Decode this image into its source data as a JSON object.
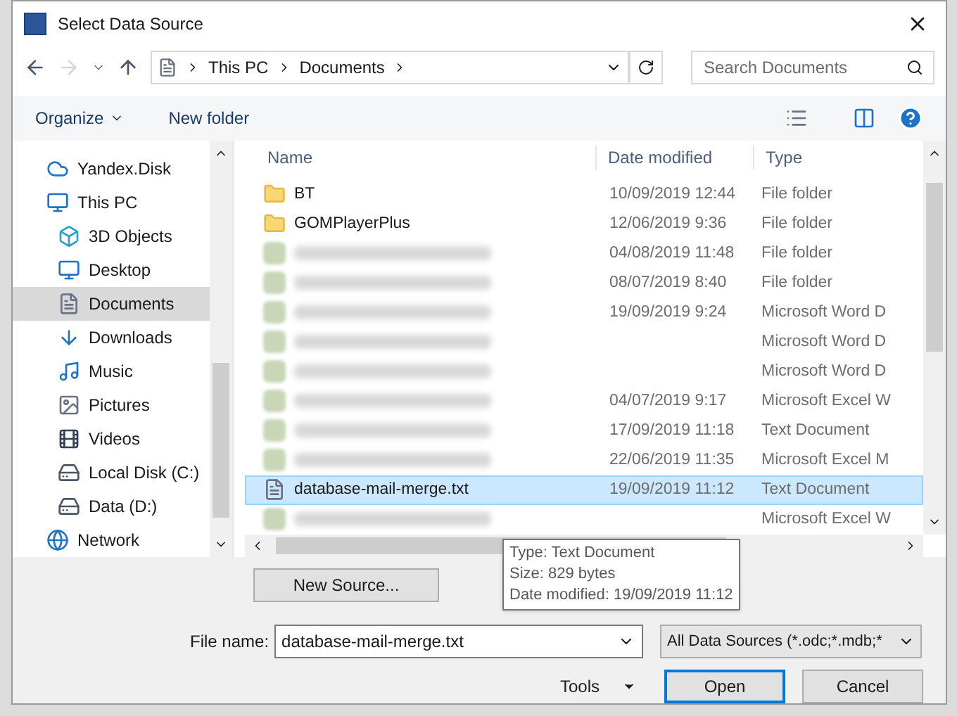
{
  "window": {
    "title": "Select Data Source"
  },
  "address": {
    "path": [
      "This PC",
      "Documents"
    ]
  },
  "search": {
    "placeholder": "Search Documents"
  },
  "toolbar": {
    "organize": "Organize",
    "new_folder": "New folder"
  },
  "sidebar": {
    "items": [
      {
        "label": "Yandex.Disk",
        "kind": "cloud",
        "selected": false
      },
      {
        "label": "This PC",
        "kind": "pc",
        "selected": false,
        "children": [
          {
            "label": "3D Objects",
            "kind": "cube",
            "selected": false
          },
          {
            "label": "Desktop",
            "kind": "desktop",
            "selected": false
          },
          {
            "label": "Documents",
            "kind": "document",
            "selected": true
          },
          {
            "label": "Downloads",
            "kind": "download",
            "selected": false
          },
          {
            "label": "Music",
            "kind": "music",
            "selected": false
          },
          {
            "label": "Pictures",
            "kind": "picture",
            "selected": false
          },
          {
            "label": "Videos",
            "kind": "video",
            "selected": false
          },
          {
            "label": "Local Disk (C:)",
            "kind": "drive",
            "selected": false
          },
          {
            "label": "Data (D:)",
            "kind": "drive",
            "selected": false
          }
        ]
      },
      {
        "label": "Network",
        "kind": "network",
        "selected": false
      }
    ]
  },
  "table": {
    "columns": [
      "Name",
      "Date modified",
      "Type"
    ],
    "rows": [
      {
        "kind": "folder",
        "name": "BT",
        "date": "10/09/2019 12:44",
        "type": "File folder",
        "selected": false
      },
      {
        "kind": "folder",
        "name": "GOMPlayerPlus",
        "date": "12/06/2019 9:36",
        "type": "File folder",
        "selected": false
      },
      {
        "kind": "obscured",
        "date": "04/08/2019 11:48",
        "type": "File folder",
        "selected": false
      },
      {
        "kind": "obscured",
        "date": "08/07/2019 8:40",
        "type": "File folder",
        "selected": false
      },
      {
        "kind": "obscured",
        "date": "19/09/2019 9:24",
        "type": "Microsoft Word D",
        "selected": false
      },
      {
        "kind": "obscured",
        "type": "Microsoft Word D",
        "selected": false
      },
      {
        "kind": "obscured",
        "type": "Microsoft Word D",
        "selected": false
      },
      {
        "kind": "obscured",
        "date": "04/07/2019 9:17",
        "type": "Microsoft Excel W",
        "selected": false
      },
      {
        "kind": "obscured",
        "date": "17/09/2019 11:18",
        "type": "Text Document",
        "selected": false
      },
      {
        "kind": "obscured",
        "date": "22/06/2019 11:35",
        "type": "Microsoft Excel M",
        "selected": false
      },
      {
        "kind": "text",
        "name": "database-mail-merge.txt",
        "date": "19/09/2019 11:12",
        "type": "Text Document",
        "selected": true
      },
      {
        "kind": "obscured",
        "type": "Microsoft Excel W",
        "selected": false
      }
    ]
  },
  "tooltip": {
    "lines": [
      "Type: Text Document",
      "Size: 829 bytes",
      "Date modified: 19/09/2019 11:12"
    ]
  },
  "new_source": "New Source...",
  "file_name": {
    "label": "File name:",
    "value": "database-mail-merge.txt"
  },
  "filter": {
    "value": "All Data Sources (*.odc;*.mdb;*"
  },
  "buttons": {
    "tools": "Tools",
    "open": "Open",
    "cancel": "Cancel"
  }
}
